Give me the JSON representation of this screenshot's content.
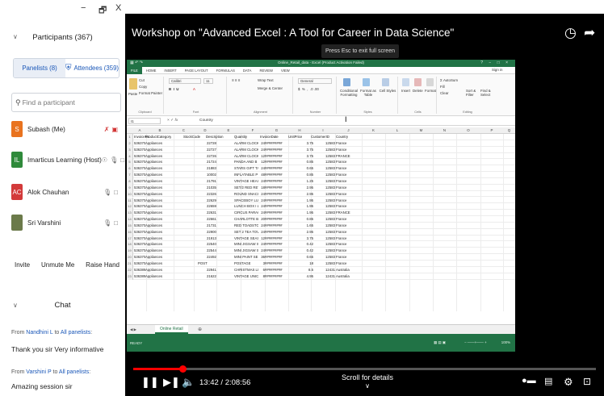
{
  "window": {
    "minimize": "−",
    "restore": "🗗",
    "close": "X"
  },
  "participants": {
    "title": "Participants (367)",
    "tab_panelists": "Panelists (8)",
    "tab_attendees": "Attendees (359)",
    "search_placeholder": "Find a participant",
    "list": [
      {
        "initials": "S",
        "name": "Subash (Me)",
        "color": "#e9731f"
      },
      {
        "initials": "IL",
        "name": "Imarticus Learning (Host)",
        "color": "#2f8a3b"
      },
      {
        "initials": "AC",
        "name": "Alok Chauhan",
        "color": "#d33a3a"
      },
      {
        "initials": "",
        "name": "Sri Varshini",
        "color": "#6b7a4a"
      }
    ],
    "invite": "Invite",
    "unmute": "Unmute Me",
    "raise_hand": "Raise Hand"
  },
  "chat": {
    "title": "Chat",
    "messages": [
      {
        "from_prefix": "From",
        "sender": "Nandhini L",
        "to_word": "to",
        "recipient": "All panelists",
        "colon": ":",
        "text": "Thank you sir Very informative"
      },
      {
        "from_prefix": "From",
        "sender": "Varshini P",
        "to_word": "to",
        "recipient": "All panelists",
        "colon": ":",
        "text": "Amazing session sir"
      }
    ]
  },
  "video": {
    "title": "Workshop on \"Advanced Excel : A Tool for Career in Data Science\"",
    "time": "13:42 / 2:08:56",
    "scroll_hint": "Scroll for details",
    "progress": 0.106,
    "tooltip": "Press Esc to exit full screen"
  },
  "excel": {
    "title": "Online_Retail_data - Excel (Product Activation Failed)",
    "menu": [
      "FILE",
      "HOME",
      "INSERT",
      "PAGE LAYOUT",
      "FORMULAS",
      "DATA",
      "REVIEW",
      "VIEW"
    ],
    "signin": "Sign in",
    "ribbon": {
      "cut": "Cut",
      "copy": "Copy",
      "format_painter": "Format Painter",
      "paste": "Paste",
      "font": "Calibri",
      "size": "11",
      "wrap": "Wrap Text",
      "merge": "Merge & Center",
      "number_format": "General",
      "cond": "Conditional Formatting",
      "fmt_table": "Format as Table",
      "cell_styles": "Cell Styles",
      "insert": "Insert",
      "delete": "Delete",
      "format": "Format",
      "autosum": "AutoSum",
      "fill": "Fill",
      "clear": "Clear",
      "sort": "Sort & Filter",
      "find": "Find & Select",
      "groups": [
        "Clipboard",
        "Font",
        "Alignment",
        "Number",
        "Styles",
        "Cells",
        "Editing"
      ]
    },
    "namebox": "I1",
    "formula": "Country",
    "columns": [
      "A",
      "B",
      "C",
      "D",
      "E",
      "F",
      "G",
      "H",
      "I",
      "J",
      "K",
      "L",
      "M",
      "N",
      "O",
      "P",
      "Q"
    ],
    "headers": [
      "InvoiceNo",
      "ProductCategory",
      "StockCode",
      "Description",
      "Quantity",
      "InvoiceDate",
      "UnitPrice",
      "CustomerID",
      "Country"
    ],
    "rows": [
      [
        "536370",
        "Appliances",
        "",
        "22728",
        "ALARM CLOCK",
        "24",
        "#########",
        "3.75",
        "12583",
        "France"
      ],
      [
        "536370",
        "Appliances",
        "",
        "22727",
        "ALARM CLOCK",
        "24",
        "#########",
        "3.75",
        "12583",
        "France"
      ],
      [
        "536370",
        "Appliances",
        "",
        "22726",
        "ALARM CLOCK",
        "12",
        "#########",
        "3.75",
        "12583",
        "FRANCE"
      ],
      [
        "536370",
        "Appliances",
        "",
        "21724",
        "PANDA AND B",
        "12",
        "#########",
        "0.85",
        "12583",
        "France"
      ],
      [
        "536370",
        "Appliances",
        "",
        "21883",
        "STARS GIFT TA",
        "24",
        "#########",
        "0.65",
        "12583",
        "France"
      ],
      [
        "536370",
        "Appliances",
        "",
        "10002",
        "INFLATABLE P",
        "48",
        "#########",
        "0.85",
        "12583",
        "France"
      ],
      [
        "536370",
        "Appliances",
        "",
        "21791",
        "VINTAGE HEAI",
        "24",
        "#########",
        "1.25",
        "12583",
        "France"
      ],
      [
        "536370",
        "Appliances",
        "",
        "21035",
        "SET/2 RED RET",
        "18",
        "#########",
        "2.95",
        "12583",
        "France"
      ],
      [
        "536370",
        "Appliances",
        "",
        "22326",
        "ROUND SNACI",
        "24",
        "#########",
        "2.95",
        "12583",
        "France"
      ],
      [
        "536370",
        "Appliances",
        "",
        "22629",
        "SPACEBOY LUI",
        "24",
        "#########",
        "1.95",
        "12583",
        "France"
      ],
      [
        "536370",
        "Appliances",
        "",
        "22659",
        "LUNCH BOX I L",
        "24",
        "#########",
        "1.95",
        "12583",
        "France"
      ],
      [
        "536370",
        "Appliances",
        "",
        "22631",
        "CIRCUS PARAC",
        "24",
        "#########",
        "1.95",
        "12583",
        "FRANCE"
      ],
      [
        "536370",
        "Appliances",
        "",
        "22661",
        "CHARLOTTE BI",
        "20",
        "#########",
        "0.85",
        "12583",
        "France"
      ],
      [
        "536370",
        "Appliances",
        "",
        "21731",
        "RED TOADSTO",
        "24",
        "#########",
        "1.65",
        "12583",
        "France"
      ],
      [
        "536370",
        "Appliances",
        "",
        "22900",
        "SET 2 TEA TOV",
        "24",
        "#########",
        "2.95",
        "12583",
        "France"
      ],
      [
        "536370",
        "Appliances",
        "",
        "21913",
        "VINTAGE SEAS",
        "12",
        "#########",
        "3.75",
        "12583",
        "France"
      ],
      [
        "536370",
        "Appliances",
        "",
        "22540",
        "MINI JIGSAW S",
        "24",
        "#########",
        "0.42",
        "12583",
        "France"
      ],
      [
        "536370",
        "Appliances",
        "",
        "22544",
        "MINI JIGSAW S",
        "24",
        "#########",
        "0.42",
        "12583",
        "France"
      ],
      [
        "536370",
        "Appliances",
        "",
        "22492",
        "MINI PAINT SE",
        "36",
        "#########",
        "0.65",
        "12583",
        "France"
      ],
      [
        "536370",
        "Appliances",
        "POST",
        "",
        "POSTAGE",
        "3",
        "#########",
        "18",
        "12583",
        "France"
      ],
      [
        "536389",
        "Appliances",
        "",
        "22941",
        "CHRISTMAS LI",
        "6",
        "#########",
        "8.5",
        "12431",
        "Australia"
      ],
      [
        "536389",
        "Appliances",
        "",
        "21622",
        "VINTAGE UNIC",
        "8",
        "#########",
        "4.95",
        "12431",
        "Australia"
      ]
    ],
    "sheet": "Online Retail",
    "status": "READY",
    "zoom": "100%"
  }
}
